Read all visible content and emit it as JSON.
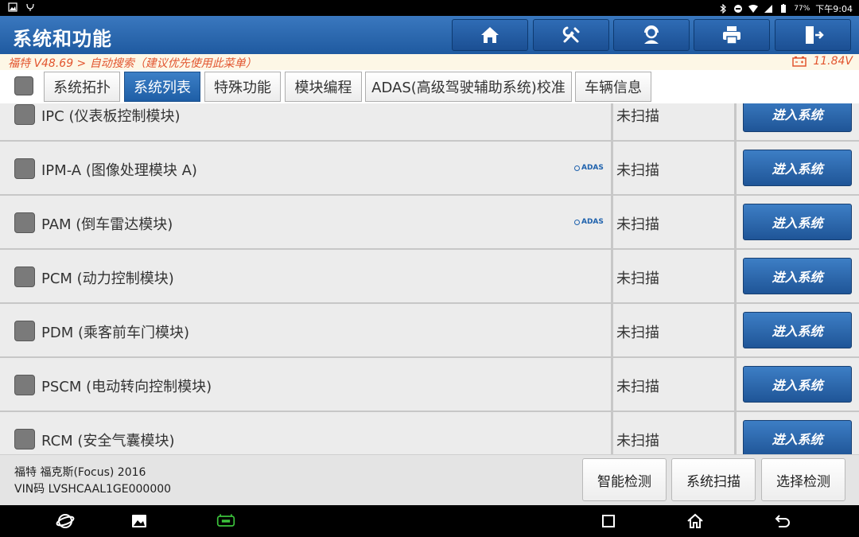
{
  "status_bar": {
    "battery_pct": "77%",
    "time": "下午9:04"
  },
  "header": {
    "title": "系统和功能",
    "buttons": [
      {
        "name": "home-button",
        "icon": "home-icon"
      },
      {
        "name": "tools-button",
        "icon": "wrench-screwdriver-icon"
      },
      {
        "name": "support-button",
        "icon": "headset-person-icon"
      },
      {
        "name": "print-button",
        "icon": "printer-icon"
      },
      {
        "name": "exit-button",
        "icon": "exit-door-icon"
      }
    ]
  },
  "info": {
    "path": "福特 V48.69 > 自动搜索（建议优先使用此菜单）",
    "voltage": "11.84V"
  },
  "tabs": [
    {
      "label": "系统拓扑",
      "active": false
    },
    {
      "label": "系统列表",
      "active": true
    },
    {
      "label": "特殊功能",
      "active": false
    },
    {
      "label": "模块编程",
      "active": false
    },
    {
      "label": "ADAS(高级驾驶辅助系统)校准",
      "active": false
    },
    {
      "label": "车辆信息",
      "active": false
    }
  ],
  "systems": [
    {
      "name": "IPC (仪表板控制模块)",
      "adas": false,
      "status": "未扫描",
      "action": "进入系统"
    },
    {
      "name": "IPM-A (图像处理模块 A)",
      "adas": true,
      "status": "未扫描",
      "action": "进入系统"
    },
    {
      "name": "PAM (倒车雷达模块)",
      "adas": true,
      "status": "未扫描",
      "action": "进入系统"
    },
    {
      "name": "PCM (动力控制模块)",
      "adas": false,
      "status": "未扫描",
      "action": "进入系统"
    },
    {
      "name": "PDM (乘客前车门模块)",
      "adas": false,
      "status": "未扫描",
      "action": "进入系统"
    },
    {
      "name": "PSCM (电动转向控制模块)",
      "adas": false,
      "status": "未扫描",
      "action": "进入系统"
    },
    {
      "name": "RCM (安全气囊模块)",
      "adas": false,
      "status": "未扫描",
      "action": "进入系统"
    }
  ],
  "adas_badge": "ADAS",
  "vehicle": {
    "model": "福特 福克斯(Focus) 2016",
    "vin": "VIN码 LVSHCAAL1GE000000"
  },
  "bottom_buttons": {
    "smart_detect": "智能检测",
    "system_scan": "系统扫描",
    "select_detect": "选择检测"
  },
  "colors": {
    "header_blue": "#1f5aa0",
    "info_orange": "#e2552f",
    "vci_green": "#3cc23c"
  }
}
